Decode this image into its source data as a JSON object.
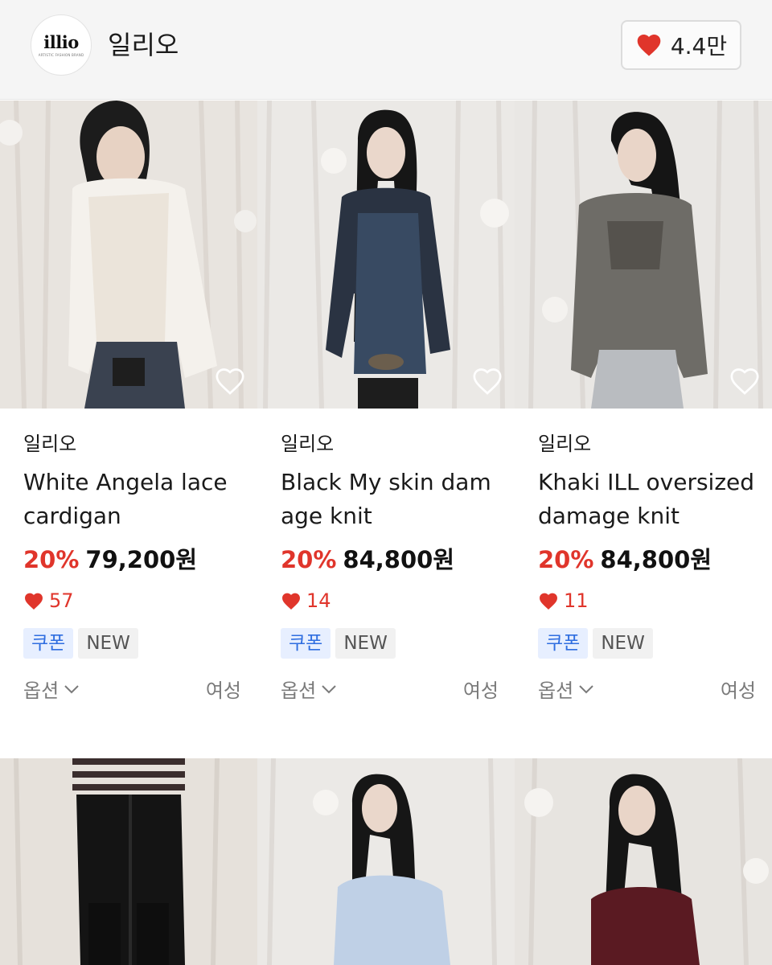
{
  "header": {
    "logo_text": "illio",
    "logo_subtext": "ARTISTIC FASHION BRAND",
    "brand_name": "일리오",
    "like_count": "4.4만"
  },
  "colors": {
    "accent_red": "#e0352b",
    "coupon_blue": "#2f6ee0",
    "header_bg": "#f5f5f5"
  },
  "products": [
    {
      "brand": "일리오",
      "name": "White Angela lace cardigan",
      "discount": "20%",
      "price": "79,200원",
      "likes": "57",
      "tags": [
        "쿠폰",
        "NEW"
      ],
      "option_label": "옵션",
      "gender": "여성"
    },
    {
      "brand": "일리오",
      "name": "Black My skin dam age knit",
      "discount": "20%",
      "price": "84,800원",
      "likes": "14",
      "tags": [
        "쿠폰",
        "NEW"
      ],
      "option_label": "옵션",
      "gender": "여성"
    },
    {
      "brand": "일리오",
      "name": "Khaki ILL oversized damage knit",
      "discount": "20%",
      "price": "84,800원",
      "likes": "11",
      "tags": [
        "쿠폰",
        "NEW"
      ],
      "option_label": "옵션",
      "gender": "여성"
    }
  ],
  "icons": {
    "header_like": "heart-filled-icon",
    "wishlist": "heart-outline-icon",
    "like_count": "heart-filled-icon",
    "option_toggle": "chevron-down-icon"
  }
}
